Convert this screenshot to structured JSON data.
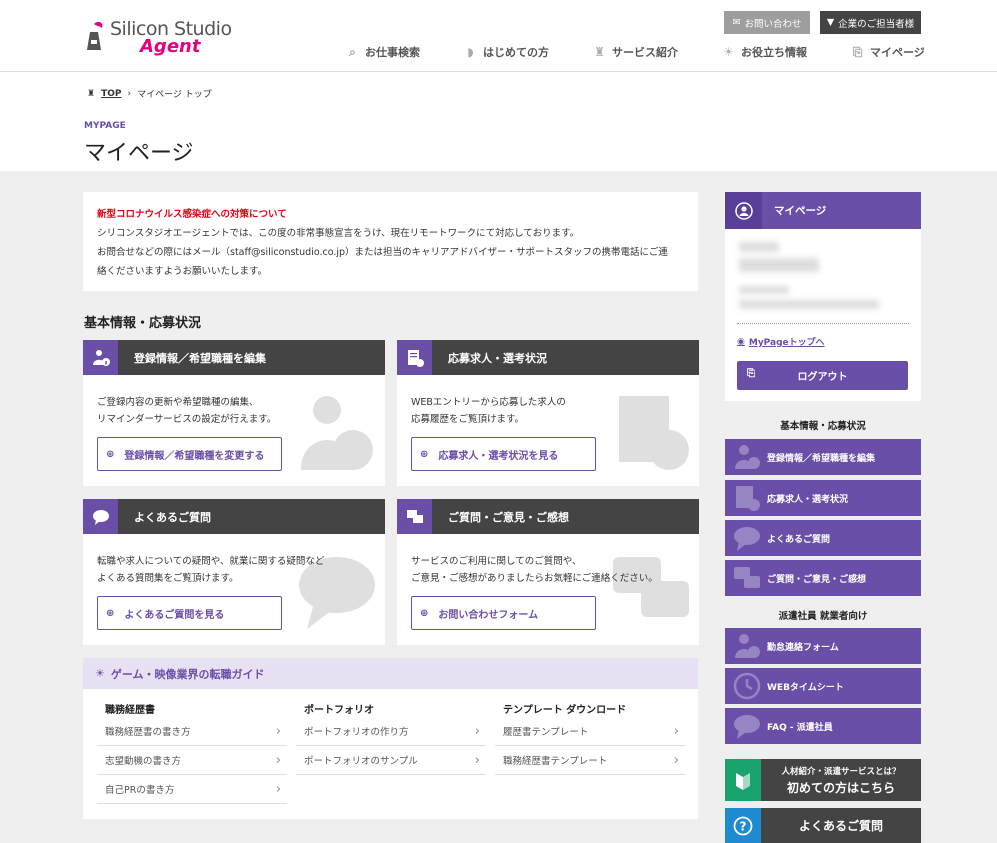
{
  "header": {
    "logo_line1": "Silicon Studio",
    "logo_line2": "Agent",
    "contact_label": "お問い合わせ",
    "corporate_label": "企業のご担当者様",
    "nav": [
      {
        "label": "お仕事検索",
        "icon": "search-icon"
      },
      {
        "label": "はじめての方",
        "icon": "beginner-icon"
      },
      {
        "label": "サービス紹介",
        "icon": "tower-icon"
      },
      {
        "label": "お役立ち情報",
        "icon": "bulb-icon"
      },
      {
        "label": "マイページ",
        "icon": "login-icon"
      }
    ]
  },
  "breadcrumb": {
    "top": "TOP",
    "current": "マイページ トップ"
  },
  "page": {
    "subtitle": "MYPAGE",
    "title": "マイページ"
  },
  "notice": {
    "heading": "新型コロナウイルス感染症への対策について",
    "line1": "シリコンスタジオエージェントでは、この度の非常事態宣言をうけ、現在リモートワークにて対応しております。",
    "line2": "お問合せなどの際にはメール（staff@siliconstudio.co.jp）または担当のキャリアアドバイザー・サポートスタッフの携帯電話にご連",
    "line3": "絡くださいますようお願いいたします。"
  },
  "section_title": "基本情報・応募状況",
  "cards": [
    {
      "title": "登録情報／希望職種を編集",
      "desc1": "ご登録内容の更新や希望職種の編集、",
      "desc2": "リマインダーサービスの設定が行えます。",
      "button": "登録情報／希望職種を変更する"
    },
    {
      "title": "応募求人・選考状況",
      "desc1": "WEBエントリーから応募した求人の",
      "desc2": "応募履歴をご覧頂けます。",
      "button": "応募求人・選考状況を見る"
    },
    {
      "title": "よくあるご質問",
      "desc1": "転職や求人についての疑問や、就業に関する疑問など",
      "desc2": "よくある質問集をご覧頂けます。",
      "button": "よくあるご質問を見る"
    },
    {
      "title": "ご質問・ご意見・ご感想",
      "desc1": "サービスのご利用に関してのご質問や、",
      "desc2": "ご意見・ご感想がありましたらお気軽にご連絡ください。",
      "button": "お問い合わせフォーム"
    }
  ],
  "guide": {
    "title": "ゲーム・映像業界の転職ガイド",
    "columns": [
      {
        "heading": "職務経歴書",
        "items": [
          "職務経歴書の書き方",
          "志望動機の書き方",
          "自己PRの書き方"
        ]
      },
      {
        "heading": "ポートフォリオ",
        "items": [
          "ポートフォリオの作り方",
          "ポートフォリオのサンプル"
        ]
      },
      {
        "heading": "テンプレート ダウンロード",
        "items": [
          "履歴書テンプレート",
          "職務経歴書テンプレート"
        ]
      }
    ]
  },
  "sidebar": {
    "title": "マイページ",
    "mypage_top": "MyPageトップへ",
    "logout": "ログアウト",
    "cat1": "基本情報・応募状況",
    "items1": [
      "登録情報／希望職種を編集",
      "応募求人・選考状況",
      "よくあるご質問",
      "ご質問・ご意見・ご感想"
    ],
    "cat2": "派遣社員 就業者向け",
    "items2": [
      "勤怠連絡フォーム",
      "WEBタイムシート",
      "FAQ - 派遣社員"
    ],
    "banner1_small": "人材紹介・派遣サービスとは？",
    "banner1_big": "初めての方はこちら",
    "banner2": "よくあるご質問"
  },
  "colors": {
    "accent": "#6a4fa8",
    "dark": "#444444",
    "brand_pink": "#e4007f",
    "green": "#1aa36f",
    "blue": "#1e8bd0"
  }
}
